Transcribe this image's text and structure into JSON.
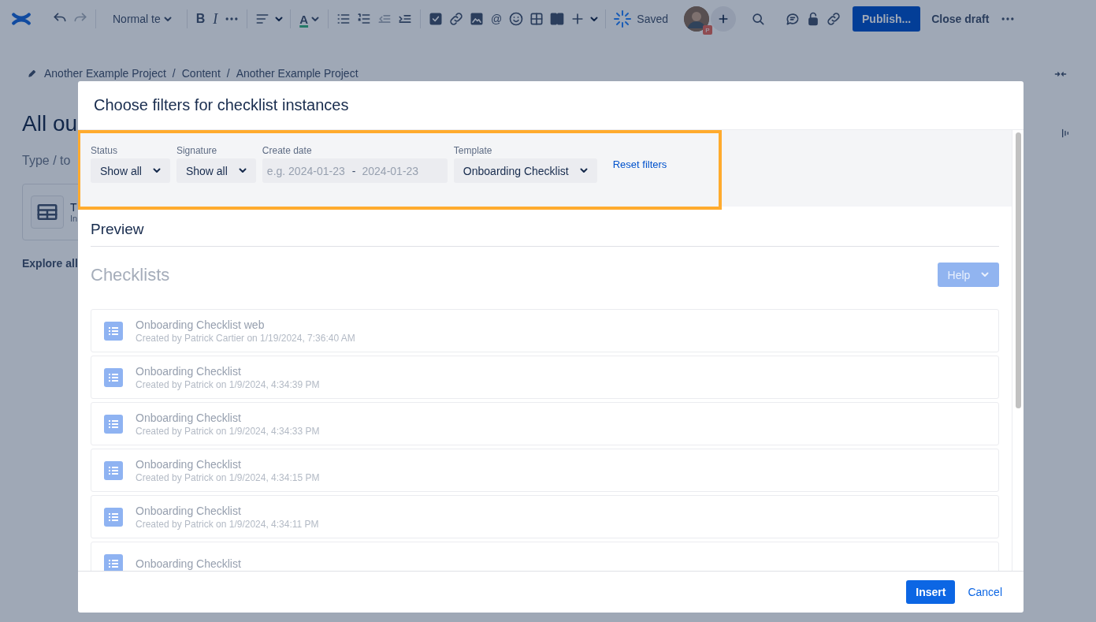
{
  "toolbar": {
    "undo": {
      "disabled": false
    },
    "redo": {
      "disabled": true
    },
    "text_style": "Normal te",
    "bold": "B",
    "italic": "I",
    "text_color": "A",
    "outdent": {
      "disabled": true
    },
    "indent": {
      "disabled": false
    },
    "mention": "@",
    "status": "Saved",
    "avatar_badge": "P",
    "publish": "Publish...",
    "close_draft": "Close draft"
  },
  "breadcrumb": {
    "separator": "/",
    "items": [
      "Another Example Project",
      "Content",
      "Another Example Project"
    ]
  },
  "page": {
    "title": "All ou",
    "prompt": "Type / to",
    "card_title": "T",
    "card_subtitle": "In",
    "explore": "Explore all"
  },
  "dialog": {
    "title": "Choose filters for checklist instances",
    "filters_highlighted": true,
    "filters": [
      {
        "kind": "select",
        "label": "Status",
        "value": "Show all"
      },
      {
        "kind": "select",
        "label": "Signature",
        "value": "Show all"
      },
      {
        "kind": "date_range",
        "label": "Create date",
        "from_placeholder": "e.g. 2024-01-23",
        "separator": "-",
        "to_placeholder": "2024-01-23"
      },
      {
        "kind": "select",
        "label": "Template",
        "value": "Onboarding Checklist"
      },
      {
        "kind": "link",
        "text": "Reset filters"
      }
    ],
    "preview": {
      "heading": "Preview",
      "title": "Checklists",
      "disabled": true,
      "help": "Help",
      "rows": [
        {
          "title": "Onboarding Checklist web",
          "subtitle": "Created by Patrick Cartier on 1/19/2024, 7:36:40 AM"
        },
        {
          "title": "Onboarding Checklist",
          "subtitle": "Created by Patrick on 1/9/2024, 4:34:39 PM"
        },
        {
          "title": "Onboarding Checklist",
          "subtitle": "Created by Patrick on 1/9/2024, 4:34:33 PM"
        },
        {
          "title": "Onboarding Checklist",
          "subtitle": "Created by Patrick on 1/9/2024, 4:34:15 PM"
        },
        {
          "title": "Onboarding Checklist",
          "subtitle": "Created by Patrick on 1/9/2024, 4:34:11 PM"
        },
        {
          "title": "Onboarding Checklist"
        }
      ]
    },
    "insert": "Insert",
    "cancel": "Cancel"
  }
}
